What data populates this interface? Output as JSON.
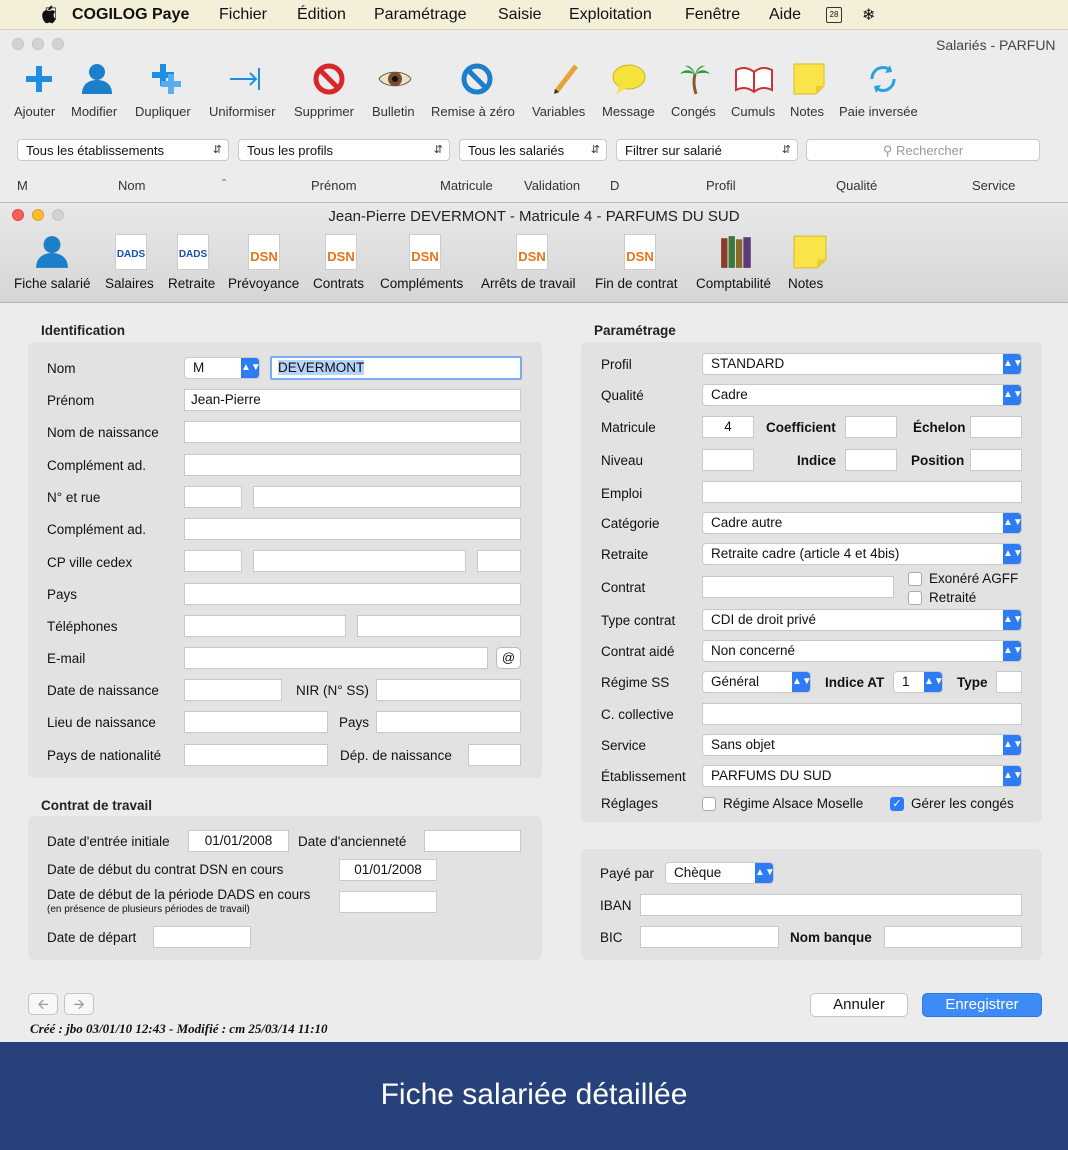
{
  "menubar": {
    "app": "COGILOG Paye",
    "items": [
      "Fichier",
      "Édition",
      "Paramétrage",
      "Saisie",
      "Exploitation",
      "Fenêtre",
      "Aide"
    ]
  },
  "back_window": {
    "title": "Salariés - PARFUN",
    "toolbar": [
      "Ajouter",
      "Modifier",
      "Dupliquer",
      "Uniformiser",
      "Supprimer",
      "Bulletin",
      "Remise à zéro",
      "Variables",
      "Message",
      "Congés",
      "Cumuls",
      "Notes",
      "Paie inversée"
    ],
    "filters": {
      "etab": "Tous les établissements",
      "profils": "Tous les profils",
      "salaries": "Tous les salariés",
      "filtrer": "Filtrer sur salarié",
      "search_placeholder": "Rechercher"
    },
    "columns": [
      "M",
      "Nom",
      "Prénom",
      "Matricule",
      "Validation",
      "D",
      "Profil",
      "Qualité",
      "Service"
    ]
  },
  "window": {
    "title": "Jean-Pierre DEVERMONT - Matricule 4 - PARFUMS DU SUD",
    "tabs": [
      "Fiche salarié",
      "Salaires",
      "Retraite",
      "Prévoyance",
      "Contrats",
      "Compléments",
      "Arrêts de travail",
      "Fin de contrat",
      "Comptabilité",
      "Notes"
    ],
    "icon_badges": {
      "dads": "DADS",
      "dsn": "DSN"
    }
  },
  "identification": {
    "title": "Identification",
    "nom_label": "Nom",
    "civilite": "M",
    "nom": "DEVERMONT",
    "prenom_label": "Prénom",
    "prenom": "Jean-Pierre",
    "nom_naissance_label": "Nom de naissance",
    "complement1_label": "Complément ad.",
    "rue_label": "N° et rue",
    "complement2_label": "Complément ad.",
    "cp_label": "CP ville cedex",
    "pays_label": "Pays",
    "tel_label": "Téléphones",
    "email_label": "E-mail",
    "email_btn": "@",
    "date_naissance_label": "Date de naissance",
    "nir_label": "NIR (N° SS)",
    "lieu_naissance_label": "Lieu de naissance",
    "pays2_label": "Pays",
    "nationalite_label": "Pays de nationalité",
    "dep_label": "Dép. de naissance"
  },
  "contrat": {
    "title": "Contrat de travail",
    "entree_label": "Date d'entrée initiale",
    "entree": "01/01/2008",
    "anciennete_label": "Date d'ancienneté",
    "dsn_label": "Date de début du contrat DSN en cours",
    "dsn": "01/01/2008",
    "dads_label": "Date de début de la période DADS en cours",
    "dads_sub": "(en présence de plusieurs périodes de travail)",
    "depart_label": "Date de départ"
  },
  "parametrage": {
    "title": "Paramétrage",
    "profil_label": "Profil",
    "profil": "STANDARD",
    "qualite_label": "Qualité",
    "qualite": "Cadre",
    "matricule_label": "Matricule",
    "matricule": "4",
    "coef_label": "Coefficient",
    "echelon_label": "Échelon",
    "niveau_label": "Niveau",
    "indice_label": "Indice",
    "position_label": "Position",
    "emploi_label": "Emploi",
    "categorie_label": "Catégorie",
    "categorie": "Cadre autre",
    "retraite_label": "Retraite",
    "retraite": "Retraite cadre (article 4 et 4bis)",
    "contrat_label": "Contrat",
    "exonere": "Exonéré AGFF",
    "retraite_chk": "Retraité",
    "type_contrat_label": "Type contrat",
    "type_contrat": "CDI de droit privé",
    "contrat_aide_label": "Contrat aidé",
    "contrat_aide": "Non concerné",
    "regime_label": "Régime SS",
    "regime": "Général",
    "indice_at_label": "Indice AT",
    "indice_at": "1",
    "type_label": "Type",
    "collective_label": "C. collective",
    "service_label": "Service",
    "service": "Sans objet",
    "etab_label": "Établissement",
    "etab": "PARFUMS DU SUD",
    "reglages_label": "Réglages",
    "alsace": "Régime Alsace Moselle",
    "conges": "Gérer les congés"
  },
  "paiement": {
    "paye_label": "Payé par",
    "paye": "Chèque",
    "iban_label": "IBAN",
    "bic_label": "BIC",
    "banque_label": "Nom banque"
  },
  "buttons": {
    "cancel": "Annuler",
    "save": "Enregistrer"
  },
  "status": "Créé : jbo 03/01/10 12:43 - Modifié : cm 25/03/14 11:10",
  "caption": "Fiche salariée détaillée",
  "colors": {
    "accent": "#2d7cf6",
    "footer": "#27417a",
    "menubar": "#f4efd8"
  }
}
